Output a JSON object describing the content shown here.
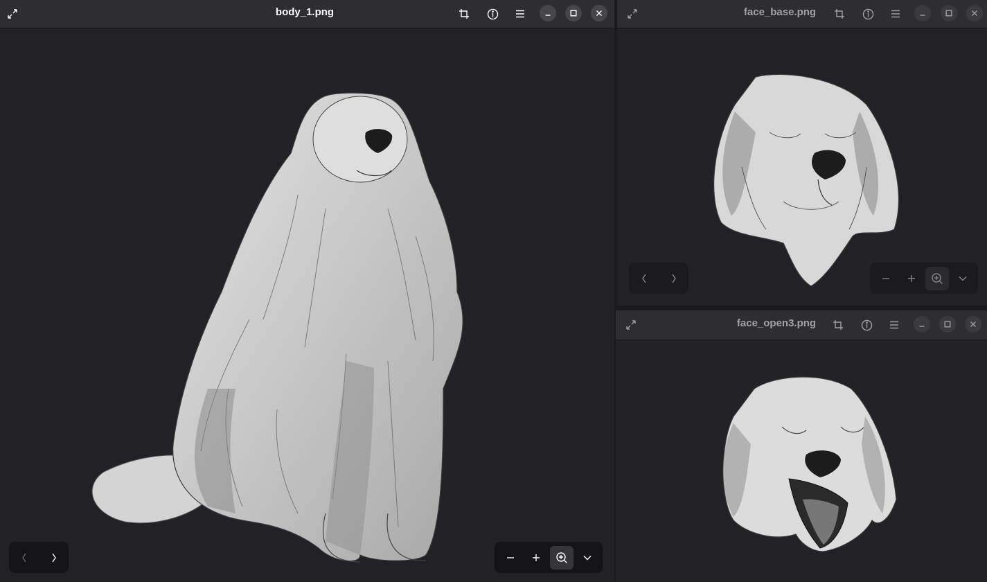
{
  "windows": {
    "main": {
      "title": "body_1.png"
    },
    "top_right": {
      "title": "face_base.png"
    },
    "bottom_right": {
      "title": "face_open3.png"
    }
  },
  "icons": {
    "fullscreen": "fullscreen-icon",
    "crop": "crop-icon",
    "info": "info-icon",
    "menu": "menu-icon",
    "minimize": "minimize-icon",
    "maximize": "maximize-icon",
    "close": "close-icon",
    "previous": "chevron-left-icon",
    "next": "chevron-right-icon",
    "zoom_out": "minus-icon",
    "zoom_in": "plus-icon",
    "zoom_fit": "zoom-icon",
    "zoom_menu": "chevron-down-icon"
  },
  "colors": {
    "background": "#222226",
    "titlebar": "#2e2e32",
    "controls": "#141416"
  }
}
